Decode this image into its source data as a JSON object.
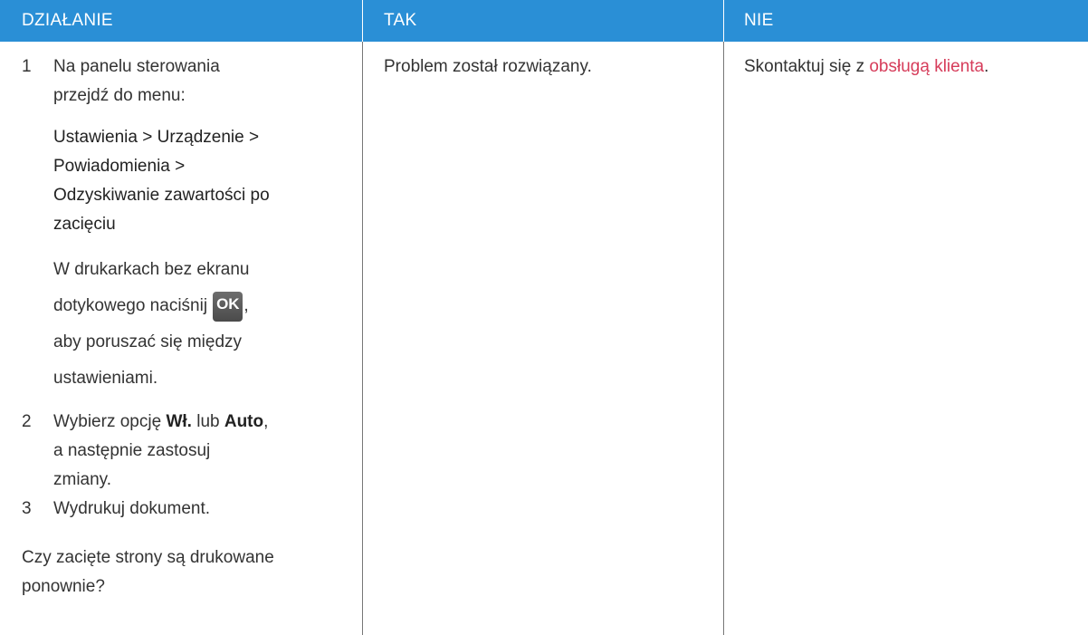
{
  "header": {
    "col1": "DZIAŁANIE",
    "col2": "TAK",
    "col3": "NIE"
  },
  "colors": {
    "header_bg": "#2a8fd6",
    "header_text": "#ffffff",
    "link": "#d63c5a"
  },
  "action": {
    "step1": {
      "number": "1",
      "text": "Na panelu sterowania przejdź do menu:",
      "menu_path": {
        "item1": "Ustawienia",
        "sep1": ">",
        "item2": "Urządzenie",
        "sep2": ">",
        "item3": "Powiadomienia",
        "sep3": ">",
        "item4": "Odzyskiwanie zawartości po zacięciu"
      },
      "note_before": "W drukarkach bez ekranu dotykowego naciśnij",
      "ok_icon": "ok-button-icon",
      "ok_label": "OK",
      "note_after": ", aby poruszać się między ustawieniami."
    },
    "step2": {
      "number": "2",
      "text_a": "Wybierz opcję",
      "opt1": "Wł.",
      "text_b": "lub",
      "opt2": "Auto",
      "text_c": ", a następnie zastosuj zmiany."
    },
    "step3": {
      "number": "3",
      "text": "Wydrukuj dokument."
    },
    "question": "Czy zacięte strony są drukowane ponownie?"
  },
  "yes": {
    "text": "Problem został rozwiązany."
  },
  "no": {
    "text_before": "Skontaktuj się z",
    "link": "obsługą klienta",
    "text_after": "."
  }
}
